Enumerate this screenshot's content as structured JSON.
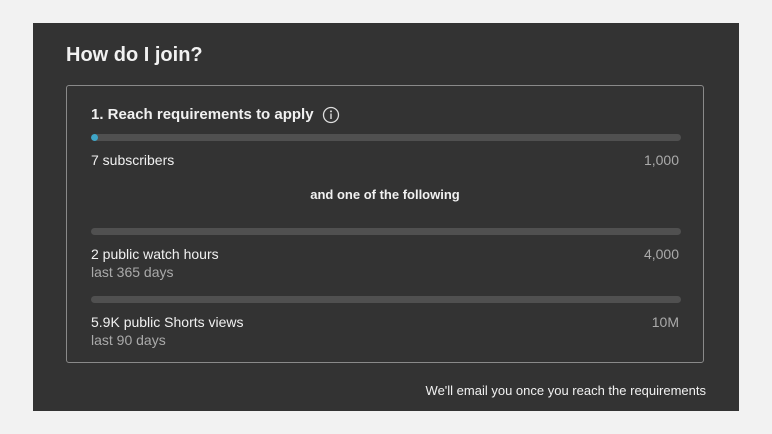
{
  "title": "How do I join?",
  "step": {
    "title": "1. Reach requirements to apply",
    "info_icon": "info-circle-icon"
  },
  "subscribers": {
    "label": "7 subscribers",
    "target": "1,000",
    "progress": 0.007
  },
  "separator": "and one of the following",
  "watch_hours": {
    "label": "2 public watch hours",
    "sublabel": "last 365 days",
    "target": "4,000",
    "progress": 0.0005
  },
  "shorts_views": {
    "label": "5.9K public Shorts views",
    "sublabel": "last 90 days",
    "target": "10M",
    "progress": 0.00059
  },
  "footer": "We'll email you once you reach the requirements",
  "colors": {
    "panel_bg": "#333333",
    "track": "#505050",
    "progress_fill": "#3ea6c8"
  }
}
